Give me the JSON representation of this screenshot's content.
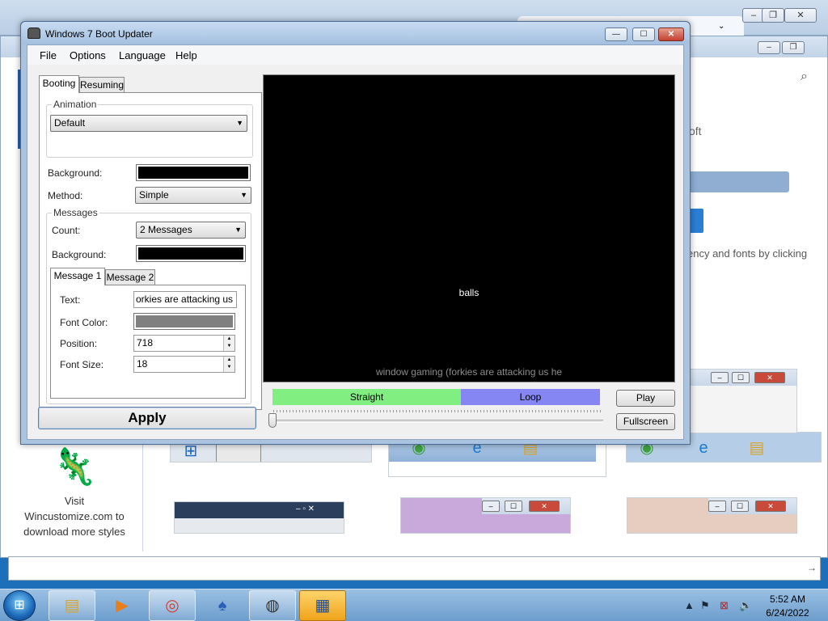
{
  "window": {
    "title": "Windows 7 Boot Updater",
    "minimize": "—",
    "maximize": "☐",
    "close": "✕"
  },
  "menu": [
    "File",
    "Options",
    "Language",
    "Help"
  ],
  "tabs": {
    "booting": "Booting",
    "resuming": "Resuming"
  },
  "animation": {
    "legend": "Animation",
    "value": "Default"
  },
  "background": {
    "label": "Background:",
    "color": "#000000"
  },
  "method": {
    "label": "Method:",
    "value": "Simple"
  },
  "messages": {
    "legend": "Messages",
    "count_label": "Count:",
    "count_value": "2 Messages",
    "background_label": "Background:",
    "background_color": "#000000",
    "tabs": [
      "Message 1",
      "Message 2"
    ],
    "text_label": "Text:",
    "text_value": "orkies are attacking us he",
    "font_color_label": "Font Color:",
    "font_color": "#808080",
    "position_label": "Position:",
    "position_value": "718",
    "font_size_label": "Font Size:",
    "font_size_value": "18"
  },
  "apply_label": "Apply",
  "preview": {
    "main_text": "balls",
    "sub_text": "window gaming (forkies are attacking us he"
  },
  "modes": {
    "straight": "Straight",
    "loop": "Loop"
  },
  "buttons": {
    "play": "Play",
    "fullscreen": "Fullscreen"
  },
  "background_windows": {
    "soft_text": "oft",
    "fonts_text": "ency and fonts by clicking",
    "promo_text": [
      "Visit",
      "Wincustomize.com to",
      "download more styles"
    ]
  },
  "taskbar": {
    "time": "5:52 AM",
    "date": "6/24/2022"
  }
}
